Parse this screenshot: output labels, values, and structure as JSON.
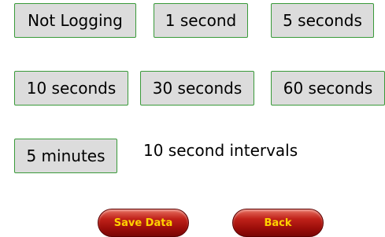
{
  "interval_options": {
    "not_logging": "Not Logging",
    "one_second": "1 second",
    "five_seconds": "5 seconds",
    "ten_seconds": "10 seconds",
    "thirty_seconds": "30 seconds",
    "sixty_seconds": "60 seconds",
    "five_minutes": "5 minutes"
  },
  "status": {
    "current_interval": "10 second intervals"
  },
  "actions": {
    "save_label": "Save Data",
    "back_label": "Back"
  },
  "colors": {
    "option_bg": "#dcdcdc",
    "option_border": "#3a9a3a",
    "action_red": "#b01810",
    "action_text": "#ffd200"
  }
}
